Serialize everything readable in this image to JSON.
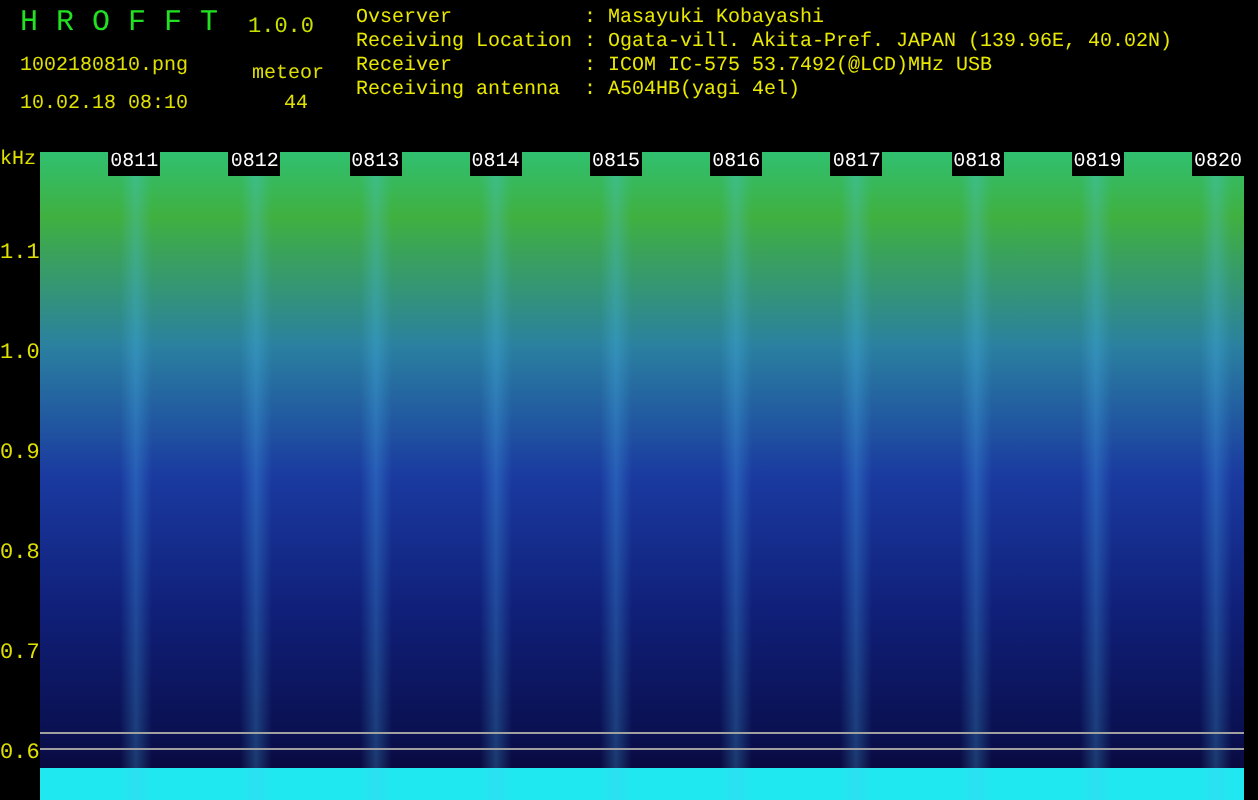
{
  "app": {
    "title": "H R O F F T",
    "version": "1.0.0",
    "file_name": "1002180810.png",
    "date_time": "10.02.18 08:10",
    "mode": "meteor",
    "count": "44"
  },
  "info": [
    {
      "label": "Ovserver",
      "separator": ":",
      "value": "Masayuki Kobayashi"
    },
    {
      "label": "Receiving Location",
      "separator": ":",
      "value": "Ogata-vill. Akita-Pref. JAPAN (139.96E, 40.02N)"
    },
    {
      "label": "Receiver",
      "separator": ":",
      "value": "ICOM IC-575 53.7492(@LCD)MHz USB"
    },
    {
      "label": "Receiving antenna",
      "separator": ":",
      "value": "A504HB(yagi 4el)"
    }
  ],
  "spectrogram": {
    "unit": "kHz",
    "time_labels": [
      "0811",
      "0812",
      "0813",
      "0814",
      "0815",
      "0816",
      "0817",
      "0818",
      "0819",
      "0820"
    ],
    "frequency_labels": [
      "1.1",
      "1.0",
      "0.9",
      "0.8",
      "0.7",
      "0.6"
    ]
  }
}
